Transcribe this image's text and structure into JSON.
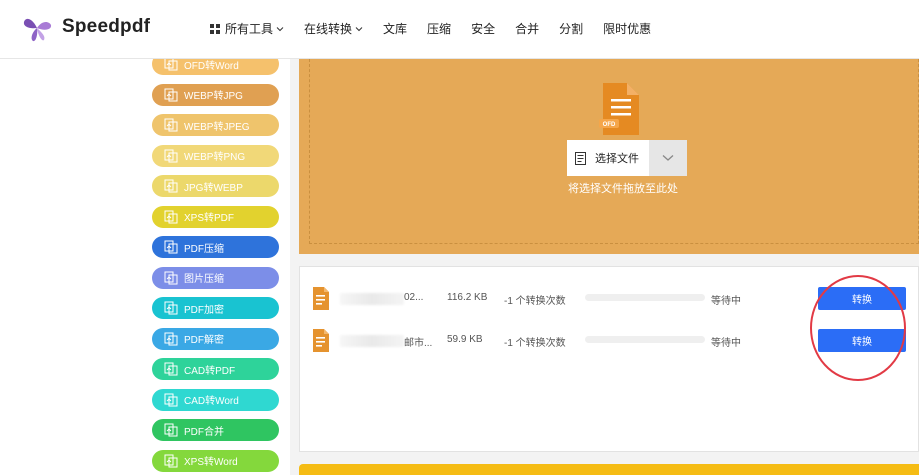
{
  "header": {
    "brand": "Speedpdf",
    "nav": [
      {
        "label": "所有工具",
        "dropdown": true,
        "icon": "grid-icon"
      },
      {
        "label": "在线转换",
        "dropdown": true
      },
      {
        "label": "文库"
      },
      {
        "label": "压缩"
      },
      {
        "label": "安全"
      },
      {
        "label": "合并"
      },
      {
        "label": "分割"
      },
      {
        "label": "限时优惠"
      }
    ]
  },
  "sidebar": {
    "items": [
      {
        "label": "OFD转Word",
        "color": "#f5c16c"
      },
      {
        "label": "WEBP转JPG",
        "color": "#e0a052"
      },
      {
        "label": "WEBP转JPEG",
        "color": "#efc46c"
      },
      {
        "label": "WEBP转PNG",
        "color": "#f1d878"
      },
      {
        "label": "JPG转WEBP",
        "color": "#ecd86b"
      },
      {
        "label": "XPS转PDF",
        "color": "#e2d22e"
      },
      {
        "label": "PDF压缩",
        "color": "#2e73db"
      },
      {
        "label": "图片压缩",
        "color": "#7c8ee8"
      },
      {
        "label": "PDF加密",
        "color": "#19c3d1"
      },
      {
        "label": "PDF解密",
        "color": "#3aa8e5"
      },
      {
        "label": "CAD转PDF",
        "color": "#2ed39a"
      },
      {
        "label": "CAD转Word",
        "color": "#2fd8d1"
      },
      {
        "label": "PDF合并",
        "color": "#2fc561"
      },
      {
        "label": "XPS转Word",
        "color": "#84d83c"
      }
    ]
  },
  "upload": {
    "file_type_badge": "OFD",
    "select_label": "选择文件",
    "hint": "将选择文件拖放至此处",
    "bg_color": "#e5a957"
  },
  "files": [
    {
      "name": "02...",
      "size": "116.2 KB",
      "count": "-1 个转换次数",
      "progress": 0,
      "status": "等待中",
      "action": "转换"
    },
    {
      "name": "邮市...",
      "size": "59.9 KB",
      "count": "-1 个转换次数",
      "progress": 0,
      "status": "等待中",
      "action": "转换"
    }
  ],
  "colors": {
    "accent": "#2b6df6",
    "highlight_circle": "#e23a45"
  }
}
